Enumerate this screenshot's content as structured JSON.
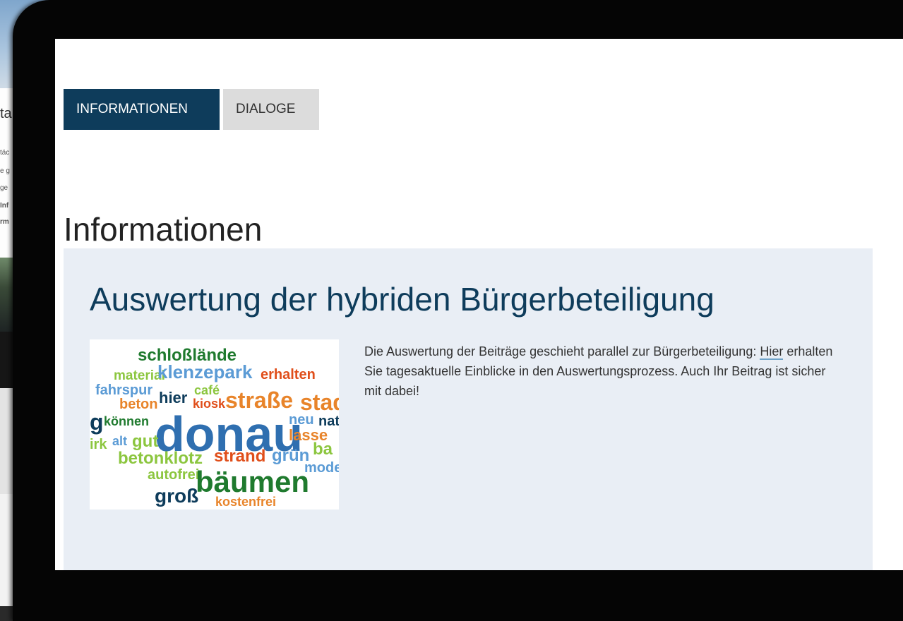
{
  "tabs": [
    {
      "label": "INFORMATIONEN",
      "active": true
    },
    {
      "label": "DIALOGE",
      "active": false
    }
  ],
  "page_title": "Informationen",
  "panel": {
    "heading": "Auswertung der hybriden Bürgerbeteiligung",
    "text_before_link": "Die Auswertung der Beiträge geschieht parallel zur Bürgerbeteiligung: ",
    "link_label": "Hier",
    "text_after_link": " erhalten Sie tagesaktuelle Einblicke in den Auswertungsprozess. Auch Ihr Beitrag ist sicher mit dabei!"
  },
  "word_cloud": {
    "words": [
      {
        "text": "schloßlände",
        "color": "#1f7a2e"
      },
      {
        "text": "material",
        "color": "#8cc63f"
      },
      {
        "text": "klenzepark",
        "color": "#5b9bd5"
      },
      {
        "text": "erhalten",
        "color": "#e04e1a"
      },
      {
        "text": "fahrspur",
        "color": "#5b9bd5"
      },
      {
        "text": "hier",
        "color": "#0e3c5b"
      },
      {
        "text": "café",
        "color": "#8cc63f"
      },
      {
        "text": "beton",
        "color": "#e8842a"
      },
      {
        "text": "kiosk",
        "color": "#e04e1a"
      },
      {
        "text": "straße",
        "color": "#e8842a"
      },
      {
        "text": "stad",
        "color": "#e8842a"
      },
      {
        "text": "g",
        "color": "#0e3c5b"
      },
      {
        "text": "können",
        "color": "#1f7a2e"
      },
      {
        "text": "donau",
        "color": "#2f6fb0"
      },
      {
        "text": "neu",
        "color": "#5b9bd5"
      },
      {
        "text": "nat",
        "color": "#0e3c5b"
      },
      {
        "text": "irk",
        "color": "#8cc63f"
      },
      {
        "text": "alt",
        "color": "#5b9bd5"
      },
      {
        "text": "gut",
        "color": "#8cc63f"
      },
      {
        "text": "lasse",
        "color": "#e8842a"
      },
      {
        "text": "betonklotz",
        "color": "#8cc63f"
      },
      {
        "text": "strand",
        "color": "#e04e1a"
      },
      {
        "text": "grün",
        "color": "#5b9bd5"
      },
      {
        "text": "ba",
        "color": "#8cc63f"
      },
      {
        "text": "mode",
        "color": "#5b9bd5"
      },
      {
        "text": "autofrei",
        "color": "#8cc63f"
      },
      {
        "text": "bäumen",
        "color": "#1f7a2e"
      },
      {
        "text": "groß",
        "color": "#0e3c5b"
      },
      {
        "text": "kostenfrei",
        "color": "#e8842a"
      }
    ]
  },
  "background_page": {
    "title_fragment": "ta",
    "lines": [
      "täc",
      "e g",
      "ge",
      "Inf",
      "rm"
    ]
  },
  "colors": {
    "tab_active_bg": "#0e3c5b",
    "tab_inactive_bg": "#dcdcdc",
    "panel_bg": "#e9eef5",
    "heading_color": "#0e3c5b",
    "link_underline": "#6fa3c9"
  }
}
